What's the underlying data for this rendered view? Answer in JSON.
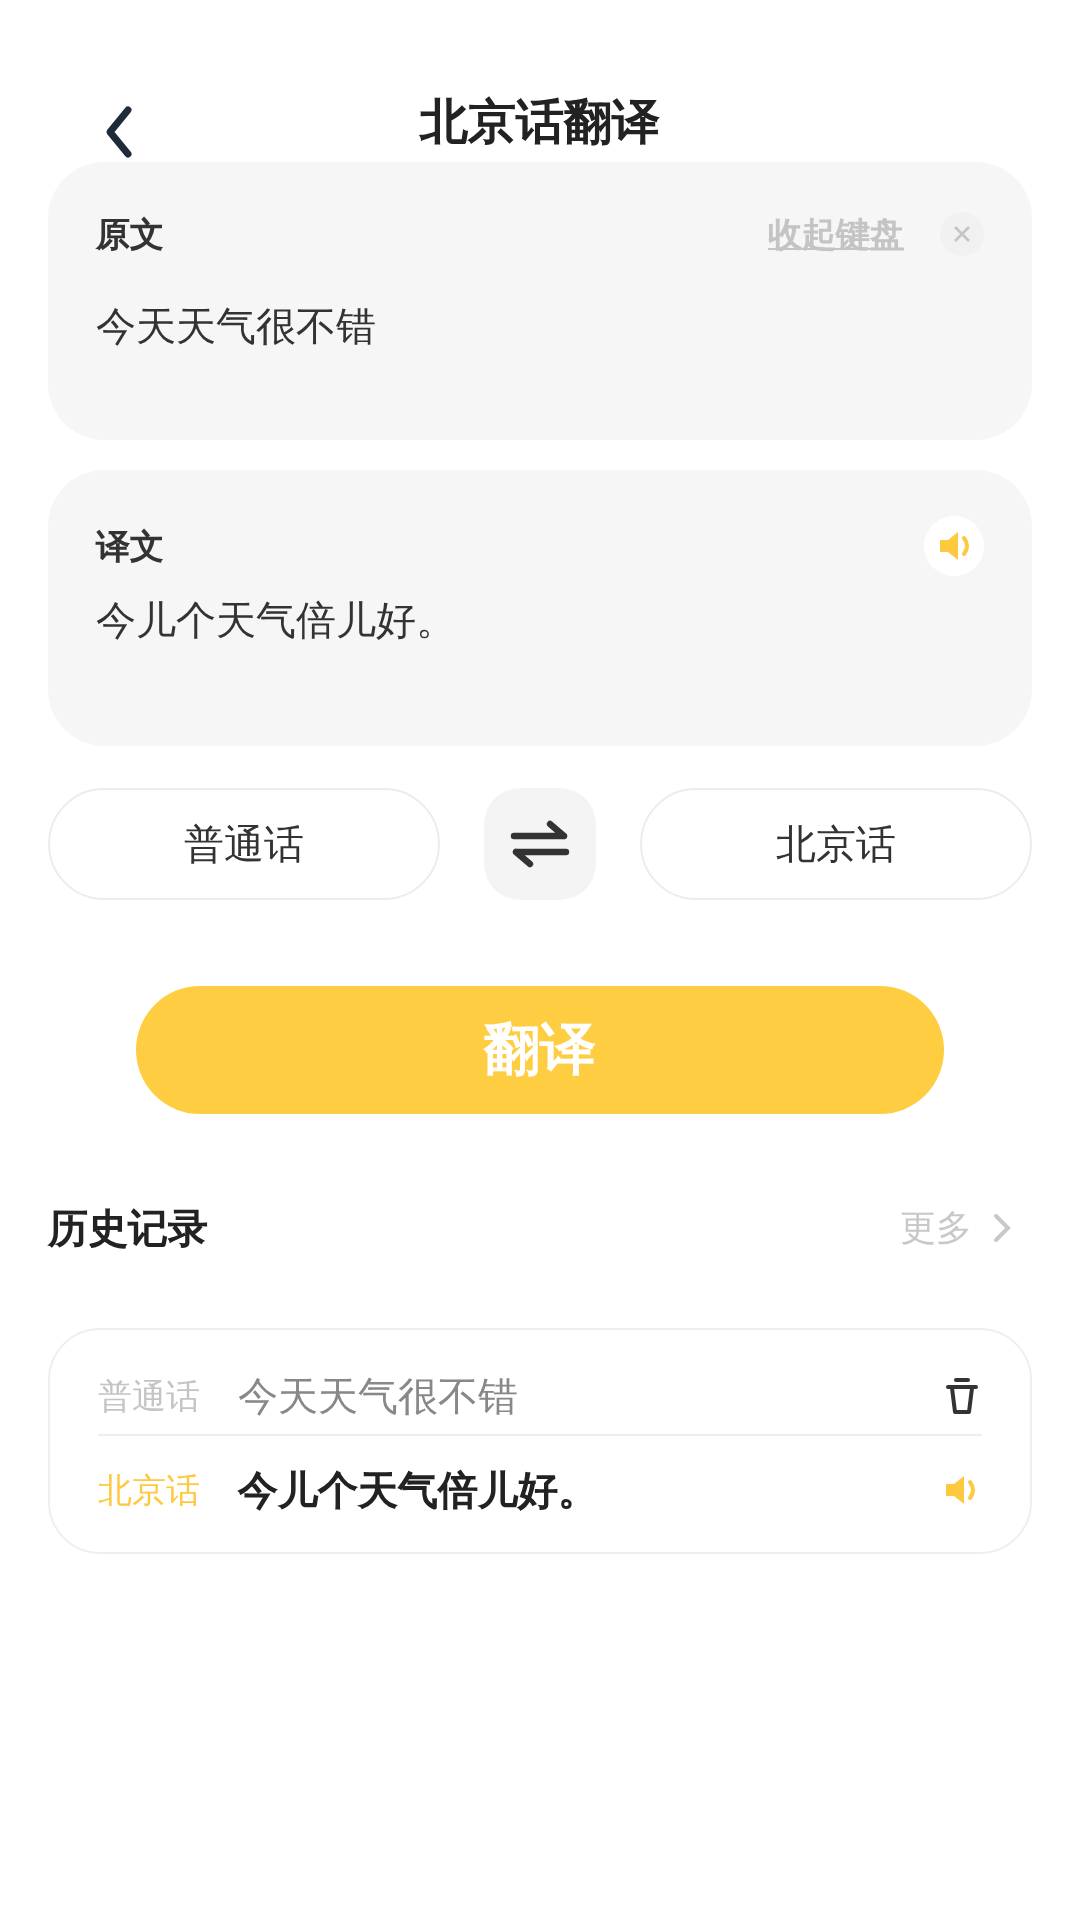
{
  "header": {
    "title": "北京话翻译"
  },
  "source": {
    "label": "原文",
    "hide_keyboard": "收起键盘",
    "value": "今天天气很不错"
  },
  "target": {
    "label": "译文",
    "text": "今儿个天气倍儿好。"
  },
  "languages": {
    "from": "普通话",
    "to": "北京话"
  },
  "translate_button": "翻译",
  "history": {
    "title": "历史记录",
    "more": "更多",
    "entries": [
      {
        "kind": "source",
        "language": "普通话",
        "text": "今天天气很不错"
      },
      {
        "kind": "target",
        "language": "北京话",
        "text": "今儿个天气倍儿好。"
      }
    ]
  }
}
